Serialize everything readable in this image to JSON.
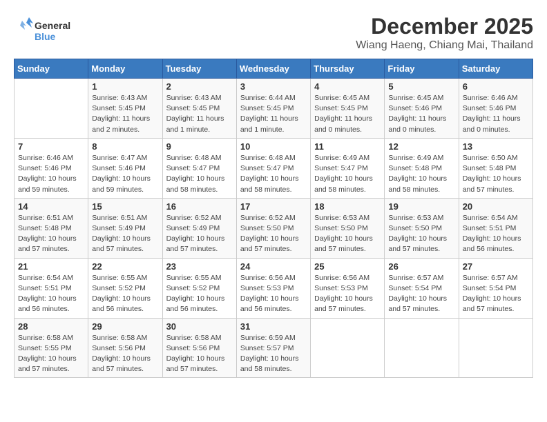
{
  "header": {
    "logo_line1": "General",
    "logo_line2": "Blue",
    "title": "December 2025",
    "subtitle": "Wiang Haeng, Chiang Mai, Thailand"
  },
  "days_of_week": [
    "Sunday",
    "Monday",
    "Tuesday",
    "Wednesday",
    "Thursday",
    "Friday",
    "Saturday"
  ],
  "weeks": [
    [
      {
        "day": "",
        "info": ""
      },
      {
        "day": "1",
        "info": "Sunrise: 6:43 AM\nSunset: 5:45 PM\nDaylight: 11 hours\nand 2 minutes."
      },
      {
        "day": "2",
        "info": "Sunrise: 6:43 AM\nSunset: 5:45 PM\nDaylight: 11 hours\nand 1 minute."
      },
      {
        "day": "3",
        "info": "Sunrise: 6:44 AM\nSunset: 5:45 PM\nDaylight: 11 hours\nand 1 minute."
      },
      {
        "day": "4",
        "info": "Sunrise: 6:45 AM\nSunset: 5:45 PM\nDaylight: 11 hours\nand 0 minutes."
      },
      {
        "day": "5",
        "info": "Sunrise: 6:45 AM\nSunset: 5:46 PM\nDaylight: 11 hours\nand 0 minutes."
      },
      {
        "day": "6",
        "info": "Sunrise: 6:46 AM\nSunset: 5:46 PM\nDaylight: 11 hours\nand 0 minutes."
      }
    ],
    [
      {
        "day": "7",
        "info": "Sunrise: 6:46 AM\nSunset: 5:46 PM\nDaylight: 10 hours\nand 59 minutes."
      },
      {
        "day": "8",
        "info": "Sunrise: 6:47 AM\nSunset: 5:46 PM\nDaylight: 10 hours\nand 59 minutes."
      },
      {
        "day": "9",
        "info": "Sunrise: 6:48 AM\nSunset: 5:47 PM\nDaylight: 10 hours\nand 58 minutes."
      },
      {
        "day": "10",
        "info": "Sunrise: 6:48 AM\nSunset: 5:47 PM\nDaylight: 10 hours\nand 58 minutes."
      },
      {
        "day": "11",
        "info": "Sunrise: 6:49 AM\nSunset: 5:47 PM\nDaylight: 10 hours\nand 58 minutes."
      },
      {
        "day": "12",
        "info": "Sunrise: 6:49 AM\nSunset: 5:48 PM\nDaylight: 10 hours\nand 58 minutes."
      },
      {
        "day": "13",
        "info": "Sunrise: 6:50 AM\nSunset: 5:48 PM\nDaylight: 10 hours\nand 57 minutes."
      }
    ],
    [
      {
        "day": "14",
        "info": "Sunrise: 6:51 AM\nSunset: 5:48 PM\nDaylight: 10 hours\nand 57 minutes."
      },
      {
        "day": "15",
        "info": "Sunrise: 6:51 AM\nSunset: 5:49 PM\nDaylight: 10 hours\nand 57 minutes."
      },
      {
        "day": "16",
        "info": "Sunrise: 6:52 AM\nSunset: 5:49 PM\nDaylight: 10 hours\nand 57 minutes."
      },
      {
        "day": "17",
        "info": "Sunrise: 6:52 AM\nSunset: 5:50 PM\nDaylight: 10 hours\nand 57 minutes."
      },
      {
        "day": "18",
        "info": "Sunrise: 6:53 AM\nSunset: 5:50 PM\nDaylight: 10 hours\nand 57 minutes."
      },
      {
        "day": "19",
        "info": "Sunrise: 6:53 AM\nSunset: 5:50 PM\nDaylight: 10 hours\nand 57 minutes."
      },
      {
        "day": "20",
        "info": "Sunrise: 6:54 AM\nSunset: 5:51 PM\nDaylight: 10 hours\nand 56 minutes."
      }
    ],
    [
      {
        "day": "21",
        "info": "Sunrise: 6:54 AM\nSunset: 5:51 PM\nDaylight: 10 hours\nand 56 minutes."
      },
      {
        "day": "22",
        "info": "Sunrise: 6:55 AM\nSunset: 5:52 PM\nDaylight: 10 hours\nand 56 minutes."
      },
      {
        "day": "23",
        "info": "Sunrise: 6:55 AM\nSunset: 5:52 PM\nDaylight: 10 hours\nand 56 minutes."
      },
      {
        "day": "24",
        "info": "Sunrise: 6:56 AM\nSunset: 5:53 PM\nDaylight: 10 hours\nand 56 minutes."
      },
      {
        "day": "25",
        "info": "Sunrise: 6:56 AM\nSunset: 5:53 PM\nDaylight: 10 hours\nand 57 minutes."
      },
      {
        "day": "26",
        "info": "Sunrise: 6:57 AM\nSunset: 5:54 PM\nDaylight: 10 hours\nand 57 minutes."
      },
      {
        "day": "27",
        "info": "Sunrise: 6:57 AM\nSunset: 5:54 PM\nDaylight: 10 hours\nand 57 minutes."
      }
    ],
    [
      {
        "day": "28",
        "info": "Sunrise: 6:58 AM\nSunset: 5:55 PM\nDaylight: 10 hours\nand 57 minutes."
      },
      {
        "day": "29",
        "info": "Sunrise: 6:58 AM\nSunset: 5:56 PM\nDaylight: 10 hours\nand 57 minutes."
      },
      {
        "day": "30",
        "info": "Sunrise: 6:58 AM\nSunset: 5:56 PM\nDaylight: 10 hours\nand 57 minutes."
      },
      {
        "day": "31",
        "info": "Sunrise: 6:59 AM\nSunset: 5:57 PM\nDaylight: 10 hours\nand 58 minutes."
      },
      {
        "day": "",
        "info": ""
      },
      {
        "day": "",
        "info": ""
      },
      {
        "day": "",
        "info": ""
      }
    ]
  ]
}
